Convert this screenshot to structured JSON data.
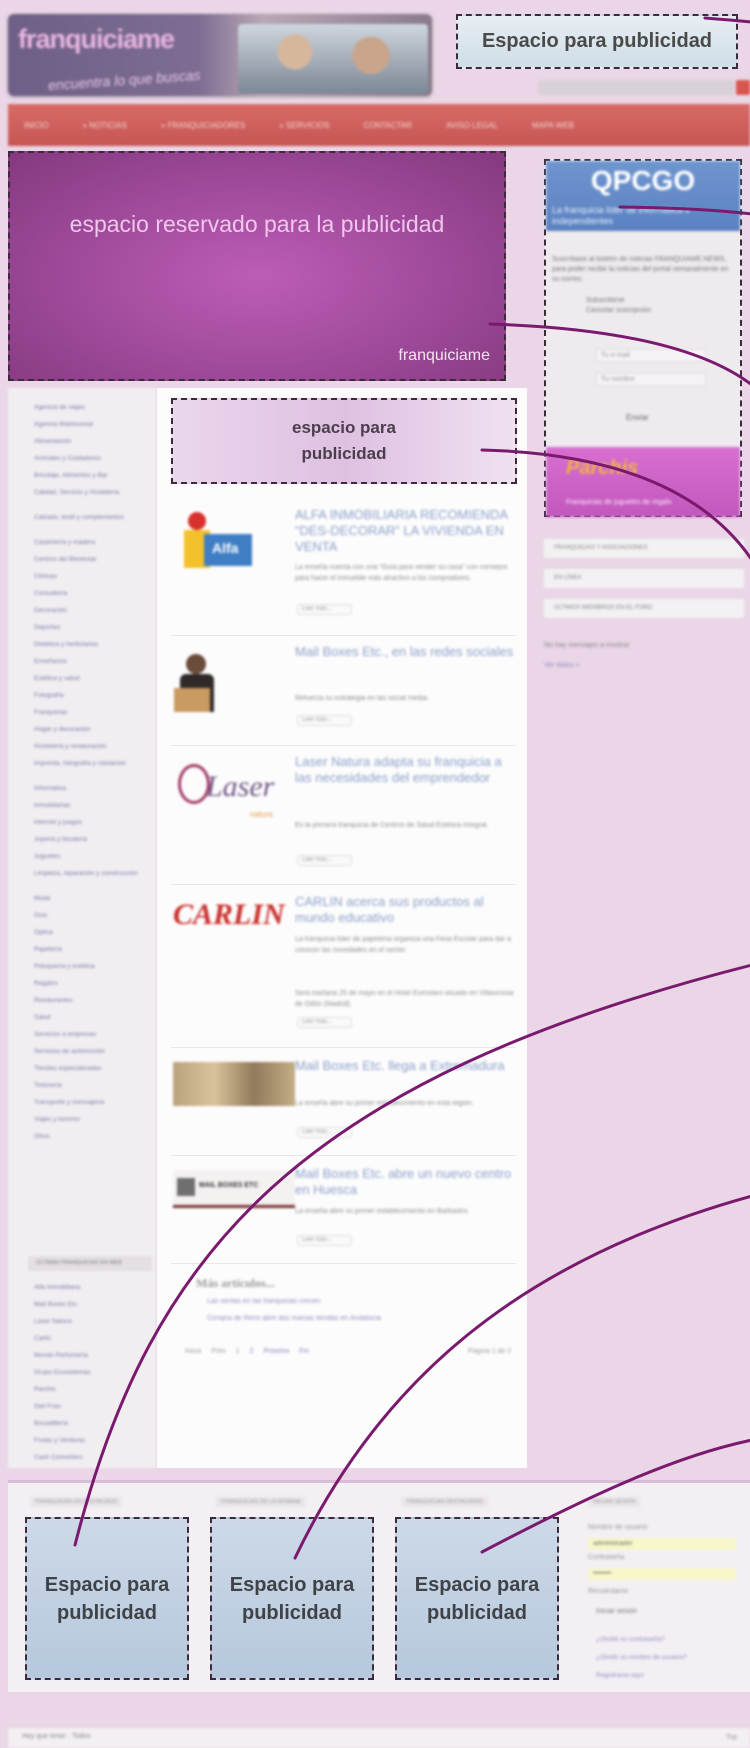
{
  "header": {
    "logo_text": "franquicia",
    "logo_suffix": "me",
    "slogan": "encuentra lo que buscas"
  },
  "top_ad": {
    "label": "Espacio para publicidad"
  },
  "nav": {
    "items": [
      "Inicio",
      "» Noticias",
      "» Franquiciadores",
      "» Servicios",
      "Contactar",
      "Aviso legal",
      "Mapa Web"
    ]
  },
  "main_ad": {
    "label": "espacio reservado para la publicidad",
    "brand": "franquiciame"
  },
  "right_ad": {
    "logo": "QPCGO",
    "tagline": "La franquicia líder de informática e independientes",
    "description": "Suscríbase al boletín de noticias FRANQUIAME.NEWS, para poder recibir la noticias del portal semanalmente en su correo.",
    "options": [
      "Subscribirse",
      "Cancelar suscripción"
    ],
    "email_placeholder": "Tu e-mail",
    "name_placeholder": "Tu nombre",
    "send": "Enviar",
    "promo_title": "Parchis",
    "promo_subtitle": "Franquicias de juguetes de regalo"
  },
  "right_sidebar": {
    "boxes": [
      "Franquicias y asociaciones",
      "En línea",
      "Últimos miembros en el foro"
    ],
    "text": [
      "No hay mensajes a mostrar",
      "Ver todos »"
    ]
  },
  "categories": {
    "items": [
      "Agencia de viajes",
      "Agencia Matrimonial",
      "Alimentación",
      "Animales y Cuidadores",
      "Bricolaje, Alimentos y Bar",
      "Calidad, Servicio y Hostelería",
      "Calzado, textil y complementos",
      "Carpintería y madera",
      "Centros del Bienestar",
      "Clínicas",
      "Consultoría",
      "Decoración",
      "Deportes",
      "Dietética y herbolarios",
      "Enseñanza",
      "Estética y salud",
      "Fotografía",
      "Franquicias",
      "Hogar y decoración",
      "Hostelería y restauración",
      "Imprenta, fotografía y rotulación",
      "Informática",
      "Inmobiliarias",
      "Internet y juegos",
      "Joyería y bisutería",
      "Juguetes",
      "Limpieza, reparación y construcción",
      "Moda",
      "Ocio",
      "Óptica",
      "Papelería",
      "Peluquería y estética",
      "Regalos",
      "Restaurantes",
      "Salud",
      "Servicios a empresas",
      "Servicios de automoción",
      "Tiendas especializadas",
      "Tintorería",
      "Transporte y mensajería",
      "Viajes y turismo",
      "Otros"
    ],
    "recent_head": "Últimas franquicias en web",
    "recent": [
      "Alfa Inmobiliaria",
      "Mail Boxes Etc.",
      "Laser Natura",
      "Carlin",
      "Mundo Perfumería",
      "Grupo Ecosistemas",
      "Parchis",
      "Diet Frau",
      "Bocadillería",
      "Frutas y Verduras",
      "Cash Converters"
    ]
  },
  "mid_ad": {
    "line1": "espacio para",
    "line2": "publicidad"
  },
  "articles": [
    {
      "title": "ALFA INMOBILIARIA RECOMIENDA “DES-DECORAR” LA VIVIENDA EN VENTA",
      "text": "La enseña cuenta con una “Guía para vender su casa” con consejos para hacer el inmueble más atractivo a los compradores.",
      "more": "Leer más..."
    },
    {
      "title": "Mail Boxes Etc., en las redes sociales",
      "text": "Refuerza su estrategia en las social media.",
      "more": "Leer más..."
    },
    {
      "title": "Laser Natura adapta su franquicia a las necesidades del emprendedor",
      "text": "Es la primera franquicia de Centros de Salud Estética Integral.",
      "more": "Leer más..."
    },
    {
      "title": "CARLIN acerca sus productos al mundo educativo",
      "text": "La franquicia líder de papelería organiza una Feria Escolar para dar a conocer las novedades en el sector.",
      "text2": "Será mañana 25 de mayo en el Hotel Eurostars situado en Villaviciosa de Odón (Madrid).",
      "more": "Leer más..."
    },
    {
      "title": "Mail Boxes Etc. llega a Extremadura",
      "text": "La enseña abre su primer establecimiento en esta región.",
      "more": "Leer más..."
    },
    {
      "title": "Mail Boxes Etc. abre un nuevo centro en Huesca",
      "text": "La enseña abre su primer establecimiento en Barbastro.",
      "more": "Leer más..."
    }
  ],
  "thumbs": {
    "alfa": "Alfa",
    "laser": "Laser",
    "laser_sub": "natura",
    "carlin": "CARLIN",
    "mbe": "MAIL BOXES ETC"
  },
  "related": {
    "title": "Más artículos...",
    "items": [
      "Las ventas en las franquicias crecen",
      "Compra de Reno abre dos nuevas tiendas en Andalucía"
    ]
  },
  "pager": {
    "items": [
      "Inicio",
      "Prev",
      "1",
      "2",
      "Próximo",
      "Fin"
    ],
    "count": "Página 1 de 2"
  },
  "bottom": {
    "heads": [
      "Franquicias en destacado",
      "Franquicias de la semana",
      "Franquicias destacadas",
      "Iniciar sesión"
    ],
    "ads": [
      {
        "line1": "Espacio para",
        "line2": "publicidad"
      },
      {
        "line1": "Espacio para",
        "line2": "publicidad"
      },
      {
        "line1": "Espacio para",
        "line2": "publicidad"
      }
    ],
    "login": {
      "user_label": "Nombre de usuario",
      "user_value": "administrador",
      "pass_label": "Contraseña",
      "pass_value": "••••••••",
      "remember": "Recuérdame",
      "submit": "Iniciar sesión",
      "links": [
        "¿Olvidó su contraseña?",
        "¿Olvidó su nombre de usuario?",
        "Registrarse aquí"
      ]
    }
  },
  "footer": {
    "text": "Hay que tener · Todos",
    "top": "Top"
  },
  "colors": {
    "nav": "#c65654",
    "annotation": "#7a1a6e",
    "main_ad": "#a44d9f"
  }
}
